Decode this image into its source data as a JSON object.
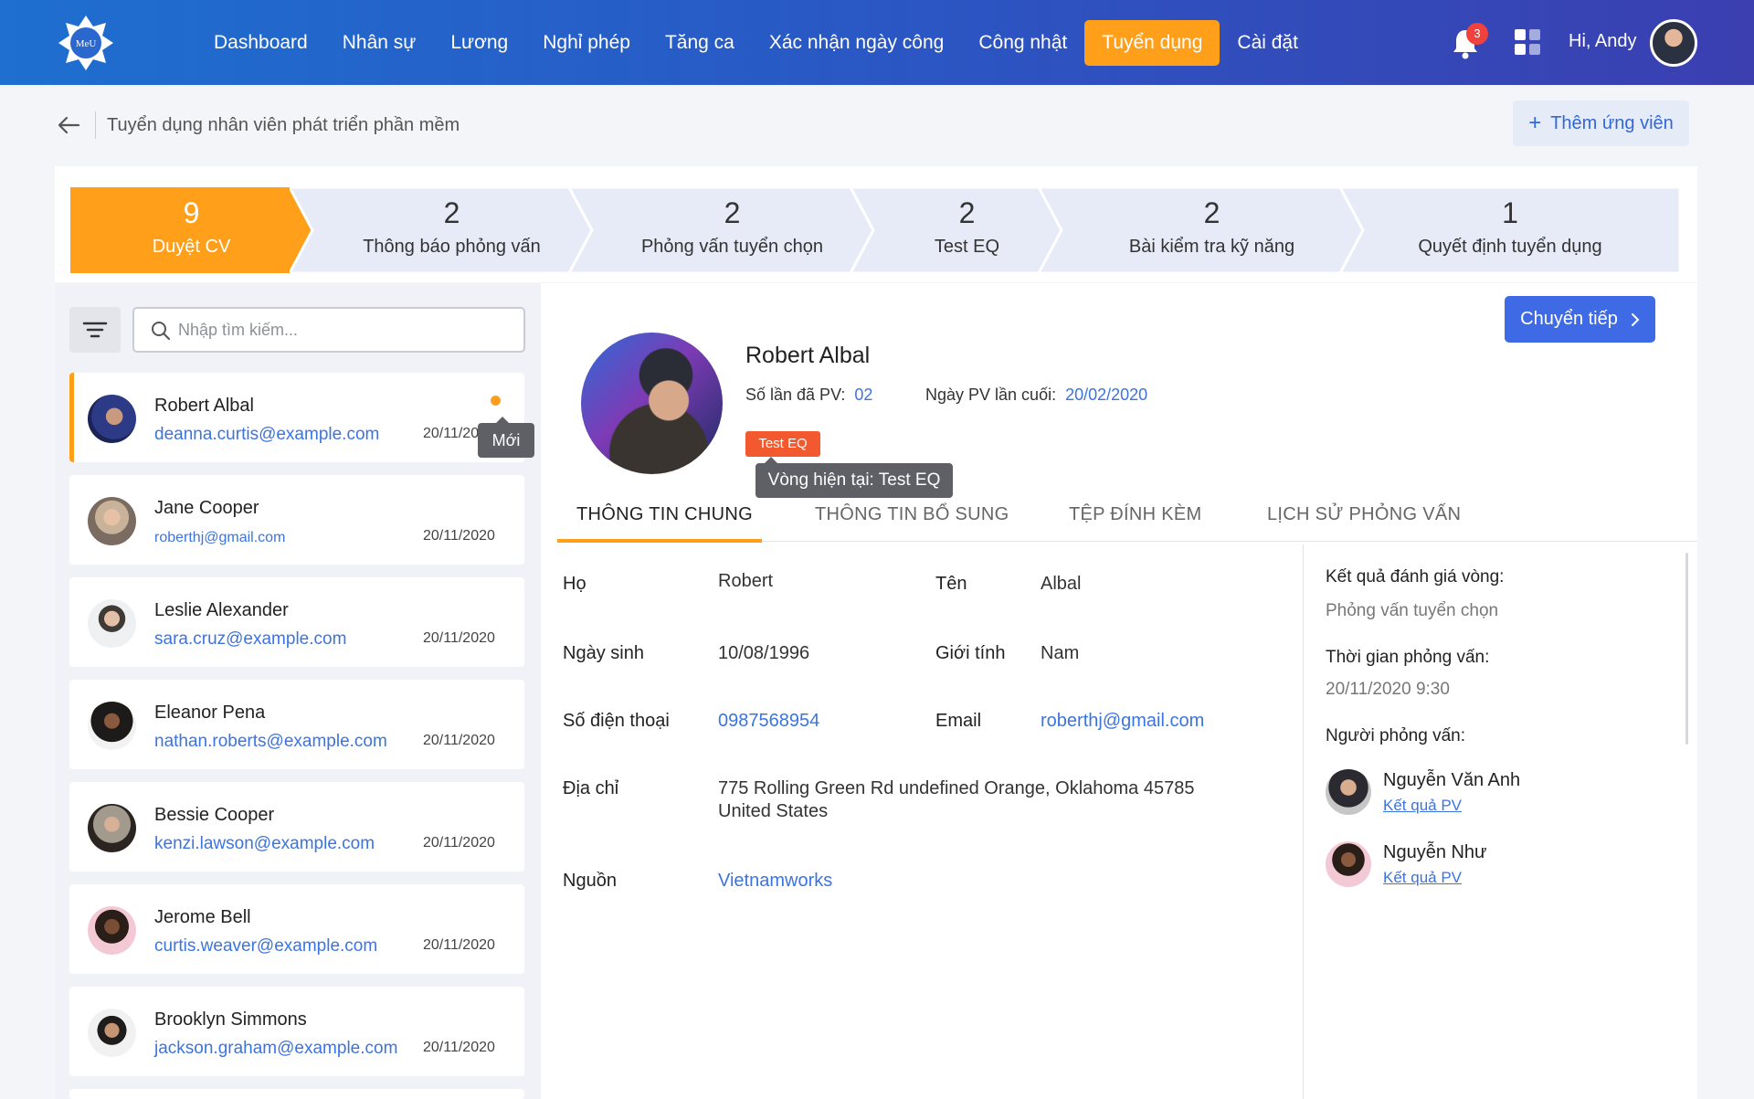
{
  "nav": {
    "items": [
      "Dashboard",
      "Nhân sự",
      "Lương",
      "Nghỉ phép",
      "Tăng ca",
      "Xác nhận ngày công",
      "Công nhật",
      "Tuyển dụng",
      "Cài đặt"
    ],
    "active": "Tuyển dụng",
    "notification_count": "3",
    "greeting": "Hi, Andy",
    "logo_text": "MeU"
  },
  "page": {
    "title": "Tuyển dụng nhân viên phát triển phần mềm",
    "add_button": "Thêm ứng viên"
  },
  "stages": [
    {
      "count": "9",
      "label": "Duyệt CV",
      "active": true
    },
    {
      "count": "2",
      "label": "Thông báo phỏng vấn"
    },
    {
      "count": "2",
      "label": "Phỏng vấn tuyển chọn"
    },
    {
      "count": "2",
      "label": "Test EQ"
    },
    {
      "count": "2",
      "label": "Bài kiểm tra kỹ năng"
    },
    {
      "count": "1",
      "label": "Quyết định tuyển dụng"
    }
  ],
  "search": {
    "placeholder": "Nhập tìm kiếm..."
  },
  "candidates": [
    {
      "name": "Robert Albal",
      "email": "deanna.curtis@example.com",
      "date": "20/11/20",
      "selected": true,
      "badge": "Mới"
    },
    {
      "name": "Jane Cooper",
      "email": "roberthj@gmail.com",
      "date": "20/11/2020"
    },
    {
      "name": "Leslie Alexander",
      "email": "sara.cruz@example.com",
      "date": "20/11/2020"
    },
    {
      "name": "Eleanor Pena",
      "email": "nathan.roberts@example.com",
      "date": "20/11/2020"
    },
    {
      "name": "Bessie Cooper",
      "email": "kenzi.lawson@example.com",
      "date": "20/11/2020"
    },
    {
      "name": "Jerome Bell",
      "email": "curtis.weaver@example.com",
      "date": "20/11/2020"
    },
    {
      "name": "Brooklyn Simmons",
      "email": "jackson.graham@example.com",
      "date": "20/11/2020"
    }
  ],
  "profile": {
    "forward_button": "Chuyển tiếp",
    "name": "Robert Albal",
    "interview_count_label": "Số lần đã PV:",
    "interview_count": "02",
    "last_interview_label": "Ngày PV lần cuối:",
    "last_interview": "20/02/2020",
    "round_tag": "Test EQ",
    "round_tooltip": "Vòng hiện tại: Test EQ"
  },
  "tabs": [
    "THÔNG TIN CHUNG",
    "THÔNG TIN BỔ SUNG",
    "TỆP ĐÍNH KÈM",
    "LỊCH SỬ PHỎNG VẤN"
  ],
  "details": {
    "ho_label": "Họ",
    "ho": "Robert",
    "ten_label": "Tên",
    "ten": "Albal",
    "dob_label": "Ngày sinh",
    "dob": "10/08/1996",
    "gender_label": "Giới tính",
    "gender": "Nam",
    "phone_label": "Số điện thoại",
    "phone": "0987568954",
    "email_label": "Email",
    "email": "roberthj@gmail.com",
    "address_label": "Địa chỉ",
    "address_line1": "775 Rolling Green Rd undefined Orange, Oklahoma 45785",
    "address_line2": "United States",
    "source_label": "Nguồn",
    "source": "Vietnamworks"
  },
  "evaluation": {
    "result_label": "Kết quả đánh giá vòng:",
    "result_round": "Phỏng vấn tuyển chọn",
    "time_label": "Thời gian phỏng vấn:",
    "time": "20/11/2020 9:30",
    "interviewers_label": "Người phỏng vấn:",
    "interviewers": [
      {
        "name": "Nguyễn Văn Anh",
        "link": "Kết quả PV"
      },
      {
        "name": "Nguyễn Như",
        "link": "Kết quả PV"
      }
    ]
  },
  "colors": {
    "accent": "#ff9f1a",
    "primary": "#3e6be5",
    "link": "#3b74e0",
    "tag": "#f2592f"
  }
}
